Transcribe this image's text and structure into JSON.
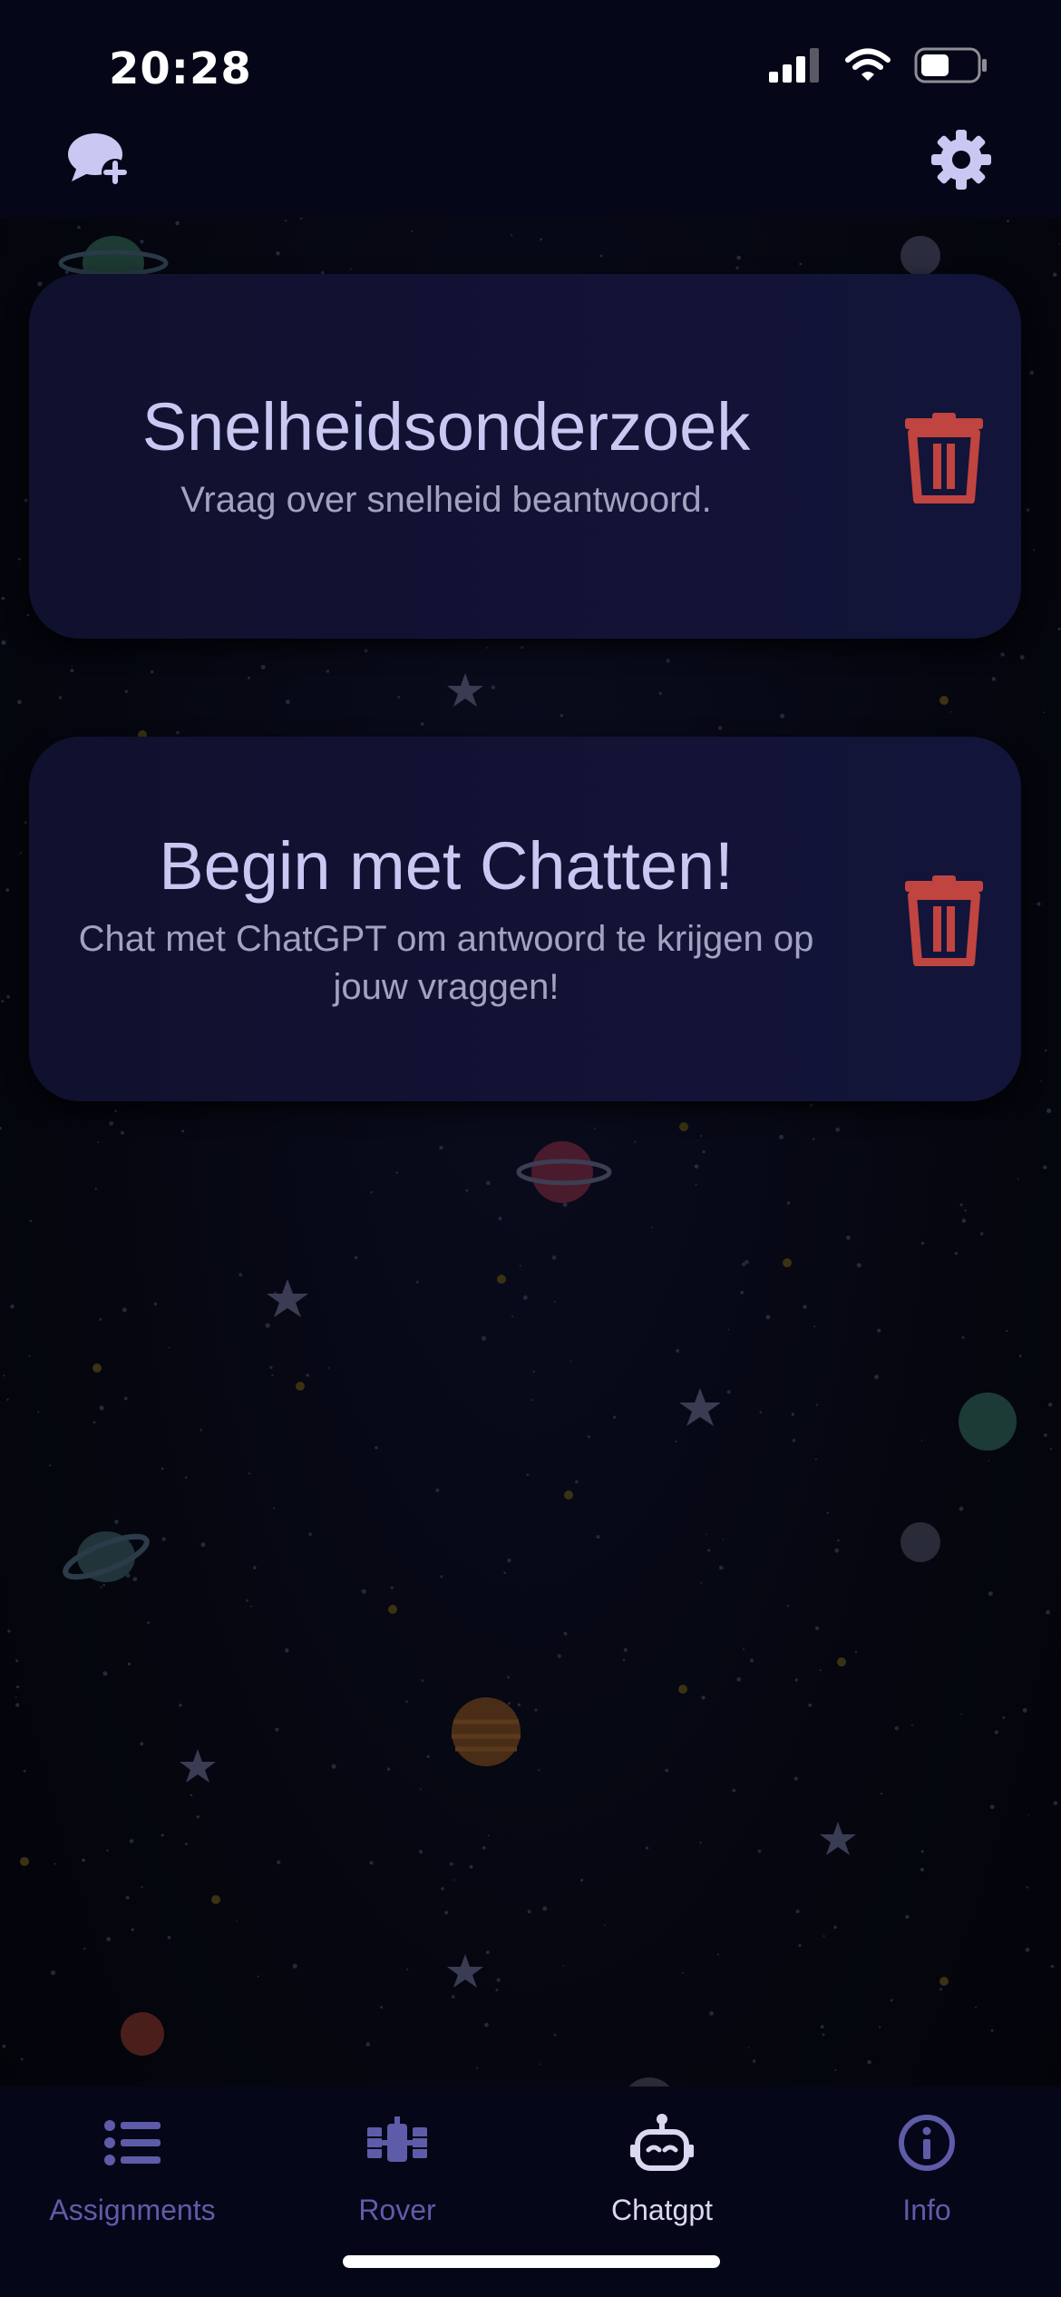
{
  "status_bar": {
    "time": "20:28",
    "signal_icon": "cellular-signal-icon",
    "wifi_icon": "wifi-icon",
    "battery_icon": "battery-icon",
    "battery_level": 0.5
  },
  "header": {
    "new_chat_icon": "chat-bubble-plus-icon",
    "settings_icon": "gear-icon"
  },
  "chats": [
    {
      "title": "Snelheidsonderzoek",
      "subtitle": "Vraag over snelheid beantwoord.",
      "delete_icon": "trash-icon"
    },
    {
      "title": "Begin met Chatten!",
      "subtitle": "Chat met ChatGPT om antwoord te krijgen op jouw vraggen!",
      "delete_icon": "trash-icon"
    }
  ],
  "tabs": [
    {
      "label": "Assignments",
      "icon": "list-icon",
      "active": false
    },
    {
      "label": "Rover",
      "icon": "satellite-icon",
      "active": false
    },
    {
      "label": "Chatgpt",
      "icon": "robot-icon",
      "active": true
    },
    {
      "label": "Info",
      "icon": "info-icon",
      "active": false
    }
  ],
  "colors": {
    "background": "#03040d",
    "card": "#11123a",
    "title_text": "#c9c8f2",
    "subtitle_text": "#a3a2c0",
    "delete": "#c0443f",
    "tab_inactive": "#5e5ca8",
    "tab_active": "#d9d8f0"
  }
}
